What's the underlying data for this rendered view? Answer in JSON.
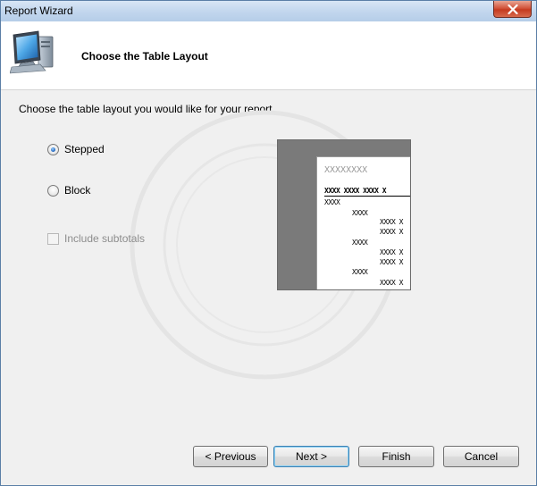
{
  "window": {
    "title": "Report Wizard"
  },
  "header": {
    "title": "Choose the Table Layout",
    "icon": "computer-monitor-icon"
  },
  "body": {
    "instruction": "Choose the table layout you would like for your report.",
    "layout_options": [
      {
        "label": "Stepped",
        "checked": true
      },
      {
        "label": "Block",
        "checked": false
      }
    ],
    "include_subtotals": {
      "label": "Include subtotals",
      "checked": false,
      "enabled": false
    }
  },
  "preview": {
    "title": "XXXXXXXX",
    "header_row": "XXXX XXXX XXXX X",
    "rows": [
      "XXXX",
      "XXXX",
      "XXXX X",
      "XXXX X",
      "XXXX",
      "XXXX X",
      "XXXX X",
      "XXXX",
      "XXXX X"
    ]
  },
  "buttons": {
    "previous": "< Previous",
    "next": "Next >",
    "finish": "Finish",
    "cancel": "Cancel"
  },
  "colors": {
    "accent": "#3c7fb1",
    "close": "#c53a1f"
  }
}
